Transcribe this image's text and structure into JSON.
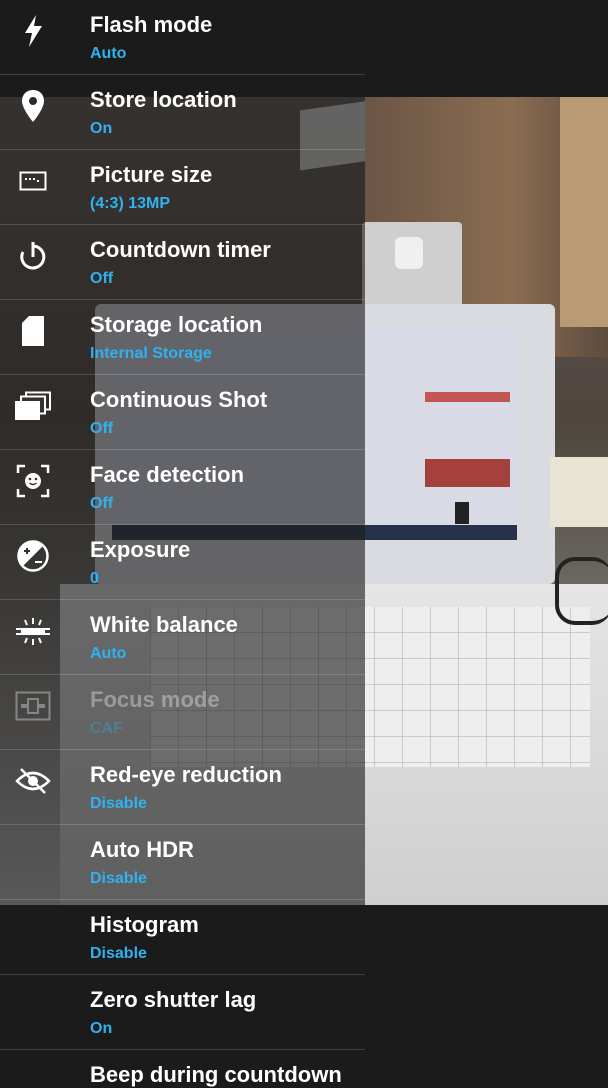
{
  "settings": [
    {
      "label": "Flash mode",
      "value": "Auto",
      "icon": "flash-icon"
    },
    {
      "label": "Store location",
      "value": "On",
      "icon": "location-pin-icon"
    },
    {
      "label": "Picture size",
      "value": "(4:3) 13MP",
      "icon": "picture-size-icon"
    },
    {
      "label": "Countdown timer",
      "value": "Off",
      "icon": "timer-icon"
    },
    {
      "label": "Storage location",
      "value": "Internal Storage",
      "icon": "sd-card-icon"
    },
    {
      "label": "Continuous Shot",
      "value": "Off",
      "icon": "continuous-shot-icon"
    },
    {
      "label": "Face detection",
      "value": "Off",
      "icon": "face-detection-icon"
    },
    {
      "label": "Exposure",
      "value": "0",
      "icon": "exposure-icon"
    },
    {
      "label": "White balance",
      "value": "Auto",
      "icon": "white-balance-icon"
    },
    {
      "label": "Focus mode",
      "value": "CAF",
      "icon": "focus-mode-icon",
      "disabled": true
    },
    {
      "label": "Red-eye reduction",
      "value": "Disable",
      "icon": "red-eye-icon"
    },
    {
      "label": "Auto HDR",
      "value": "Disable",
      "icon": ""
    },
    {
      "label": "Histogram",
      "value": "Disable",
      "icon": ""
    },
    {
      "label": "Zero shutter lag",
      "value": "On",
      "icon": ""
    },
    {
      "label": "Beep during countdown",
      "value": "",
      "icon": ""
    }
  ],
  "colors": {
    "accent": "#2fb2f0",
    "panel": "#1c1c1c"
  }
}
